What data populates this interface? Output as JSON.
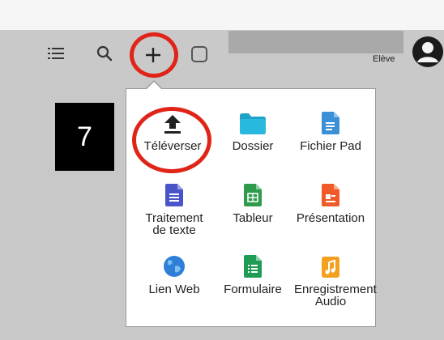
{
  "toolbar": {
    "list_icon": "list-icon",
    "search_icon": "search-icon",
    "add_icon": "plus-icon",
    "square_icon": "square-icon"
  },
  "user": {
    "role": "Elève"
  },
  "annotation": {
    "step_number": "7",
    "highlight_color": "#e02418"
  },
  "menu": {
    "items": [
      {
        "label": "Téléverser",
        "icon": "upload-icon",
        "color": "#222222"
      },
      {
        "label": "Dossier",
        "icon": "folder-icon",
        "color": "#1fa2c8"
      },
      {
        "label": "Fichier Pad",
        "icon": "pad-file-icon",
        "color": "#3b8fd6"
      },
      {
        "label": "Traitement de texte",
        "icon": "text-document-icon",
        "color": "#4a54c9"
      },
      {
        "label": "Tableur",
        "icon": "spreadsheet-icon",
        "color": "#2e9a4c"
      },
      {
        "label": "Présentation",
        "icon": "presentation-icon",
        "color": "#f05a28"
      },
      {
        "label": "Lien Web",
        "icon": "web-link-icon",
        "color": "#2f7fd8"
      },
      {
        "label": "Formulaire",
        "icon": "form-icon",
        "color": "#1f9b55"
      },
      {
        "label": "Enregistrement Audio",
        "icon": "audio-record-icon",
        "color": "#f2a01e"
      }
    ]
  }
}
